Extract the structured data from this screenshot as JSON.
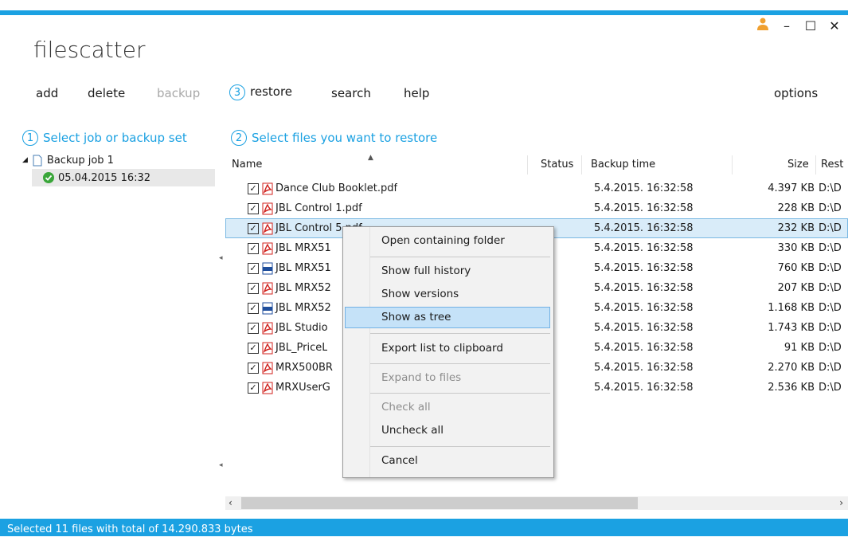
{
  "app": {
    "title": "filescatter"
  },
  "window_controls": {
    "user": "user-icon",
    "minimize": "–",
    "maximize": "☐",
    "close": "✕"
  },
  "toolbar": {
    "add": "add",
    "delete": "delete",
    "backup": "backup",
    "restore_step": "3",
    "restore": "restore",
    "search": "search",
    "help": "help",
    "options": "options"
  },
  "left": {
    "step": "1",
    "title": "Select job or backup set",
    "job": "Backup job 1",
    "backup_set": "05.04.2015 16:32"
  },
  "right": {
    "step": "2",
    "title": "Select files you want to restore",
    "columns": {
      "name": "Name",
      "status": "Status",
      "backup_time": "Backup time",
      "size": "Size",
      "restore": "Rest"
    }
  },
  "files": [
    {
      "name": "Dance Club Booklet.pdf",
      "time": "5.4.2015. 16:32:58",
      "size": "4.397 KB",
      "path": "D:\\D",
      "type": "pdf"
    },
    {
      "name": "JBL Control 1.pdf",
      "time": "5.4.2015. 16:32:58",
      "size": "228 KB",
      "path": "D:\\D",
      "type": "pdf"
    },
    {
      "name": "JBL Control 5.pdf",
      "time": "5.4.2015. 16:32:58",
      "size": "232 KB",
      "path": "D:\\D",
      "type": "pdf"
    },
    {
      "name": "JBL MRX51",
      "time": "5.4.2015. 16:32:58",
      "size": "330 KB",
      "path": "D:\\D",
      "type": "pdf"
    },
    {
      "name": "JBL MRX51",
      "time": "5.4.2015. 16:32:58",
      "size": "760 KB",
      "path": "D:\\D",
      "type": "tiff"
    },
    {
      "name": "JBL MRX52",
      "time": "5.4.2015. 16:32:58",
      "size": "207 KB",
      "path": "D:\\D",
      "type": "pdf"
    },
    {
      "name": "JBL MRX52",
      "time": "5.4.2015. 16:32:58",
      "size": "1.168 KB",
      "path": "D:\\D",
      "type": "tiff"
    },
    {
      "name": "JBL Studio",
      "time": "5.4.2015. 16:32:58",
      "size": "1.743 KB",
      "path": "D:\\D",
      "type": "pdf"
    },
    {
      "name": "JBL_PriceL",
      "time": "5.4.2015. 16:32:58",
      "size": "91 KB",
      "path": "D:\\D",
      "type": "pdf"
    },
    {
      "name": "MRX500BR",
      "time": "5.4.2015. 16:32:58",
      "size": "2.270 KB",
      "path": "D:\\D",
      "type": "pdf"
    },
    {
      "name": "MRXUserG",
      "time": "5.4.2015. 16:32:58",
      "size": "2.536 KB",
      "path": "D:\\D",
      "type": "pdf"
    }
  ],
  "context_menu": [
    {
      "label": "Open containing folder",
      "disabled": false
    },
    {
      "label": "Show full history",
      "disabled": false
    },
    {
      "label": "Show versions",
      "disabled": false
    },
    {
      "label": "Show as tree",
      "disabled": false,
      "highlighted": true
    },
    {
      "label": "Export list to clipboard",
      "disabled": false
    },
    {
      "label": "Expand to files",
      "disabled": true
    },
    {
      "label": "Check all",
      "disabled": true
    },
    {
      "label": "Uncheck all",
      "disabled": false
    },
    {
      "label": "Cancel",
      "disabled": false
    }
  ],
  "status": {
    "text": "Selected 11 files with total of 14.290.833 bytes"
  },
  "colors": {
    "accent": "#1ba1e2",
    "pdf_red": "#d0211c",
    "tiff_blue": "#1f4e9c"
  }
}
